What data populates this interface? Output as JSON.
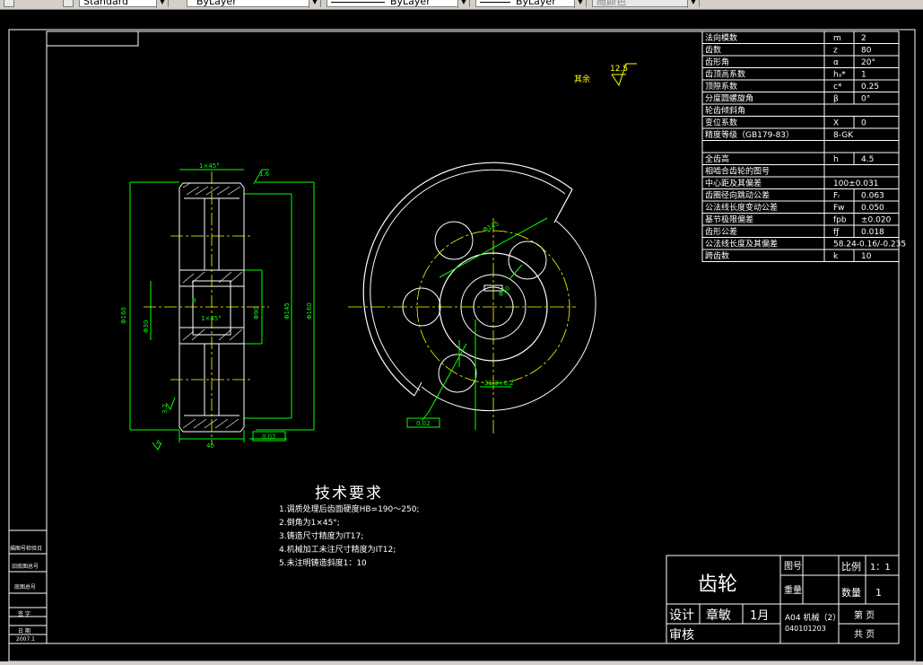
{
  "toolbar": {
    "text_style": "Standard",
    "layer": "ByLayer",
    "linetype": "ByLayer",
    "lineweight": "ByLayer",
    "color": "随颜色"
  },
  "params": [
    {
      "label": "法向模数",
      "sym": "m",
      "val": "2"
    },
    {
      "label": "齿数",
      "sym": "z",
      "val": "80"
    },
    {
      "label": "齿形角",
      "sym": "α",
      "val": "20°"
    },
    {
      "label": "齿顶高系数",
      "sym": "hₐ*",
      "val": "1"
    },
    {
      "label": "顶隙系数",
      "sym": "c*",
      "val": "0.25"
    },
    {
      "label": "分度圆螺旋角",
      "sym": "β",
      "val": "0°"
    },
    {
      "label": "轮齿倾斜角",
      "sym": "",
      "val": ""
    },
    {
      "label": "变位系数",
      "sym": "X",
      "val": "0"
    },
    {
      "label": "精度等级（GB179-83）",
      "sym": "",
      "val": "8-GK"
    },
    {
      "label": "",
      "sym": "",
      "val": ""
    },
    {
      "label": "全齿高",
      "sym": "h",
      "val": "4.5"
    },
    {
      "label": "相啮合齿轮的图号",
      "sym": "",
      "val": ""
    },
    {
      "label": "中心距及其偏差",
      "sym": "",
      "val": "100±0.031"
    },
    {
      "label": "齿圈径向跳动公差",
      "sym": "Fᵣ",
      "val": "0.063"
    },
    {
      "label": "公法线长度变动公差",
      "sym": "Fw",
      "val": "0.050"
    },
    {
      "label": "基节极限偏差",
      "sym": "fpb",
      "val": "±0.020"
    },
    {
      "label": "齿形公差",
      "sym": "fƒ",
      "val": "0.018"
    },
    {
      "label": "公法线长度及其偏差",
      "sym": "",
      "val": "58.24-0.16/-0.235"
    },
    {
      "label": "跨齿数",
      "sym": "k",
      "val": "10"
    }
  ],
  "roughness": {
    "other": "其余",
    "value": "12.5"
  },
  "annotations": {
    "chamfer_top": "1×45°",
    "chamfer_mid": "1×45°",
    "rough16": "1.6",
    "dims_left": "Φ160",
    "dim_d1": "Φ145",
    "dim_d2": "Φ160",
    "dim_bore": "Φ30",
    "dim_keyway": "31.3+0.2",
    "dim_width": "40",
    "dim_width2": "8",
    "rough32": "3.2",
    "tol_flat": "0.02",
    "label_a": "A",
    "circle_label": "Φ90",
    "hub": "Φ50"
  },
  "tech": {
    "title": "技术要求",
    "items": [
      "1.调质处理后齿面硬度HB=190～250;",
      "2.倒角为1×45°;",
      "3.铸造尺寸精度为IT17;",
      "4.机械加工未注尺寸精度为IT12;",
      "5.未注明铸造斜度1：10"
    ]
  },
  "sidebar": [
    "描图号检验日",
    "旧底图总号",
    "底图总号",
    "签 字",
    "日 期",
    "2007.1"
  ],
  "title_block": {
    "name": "齿轮",
    "drawing_no_label": "图号",
    "scale_label": "比例",
    "scale_value": "1：1",
    "weight_label": "重量",
    "qty_label": "数量",
    "qty_value": "1",
    "design_label": "设计",
    "designer": "章敏",
    "date": "1月",
    "check_label": "审核",
    "class_info": "A04 机械（2）",
    "student_no": "040101203",
    "page_label": "第  页",
    "total_label": "共  页"
  }
}
